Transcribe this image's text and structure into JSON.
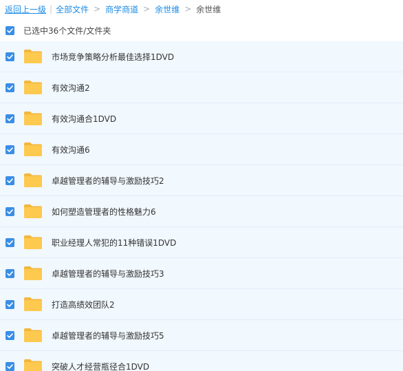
{
  "breadcrumb": {
    "back": "返回上一级",
    "separator": "|",
    "items": [
      "全部文件",
      "商学商道",
      "余世维"
    ],
    "current": "余世维"
  },
  "selection": {
    "text": "已选中36个文件/文件夹",
    "checked": true
  },
  "files": [
    {
      "name": "市场竞争策略分析最佳选择1DVD",
      "checked": true
    },
    {
      "name": "有效沟通2",
      "checked": true
    },
    {
      "name": "有效沟通合1DVD",
      "checked": true
    },
    {
      "name": "有效沟通6",
      "checked": true
    },
    {
      "name": "卓越管理者的辅导与激励技巧2",
      "checked": true
    },
    {
      "name": "如何塑造管理者的性格魅力6",
      "checked": true
    },
    {
      "name": "职业经理人常犯的11种错误1DVD",
      "checked": true
    },
    {
      "name": "卓越管理者的辅导与激励技巧3",
      "checked": true
    },
    {
      "name": "打造高绩效团队2",
      "checked": true
    },
    {
      "name": "卓越管理者的辅导与激励技巧5",
      "checked": true
    },
    {
      "name": "突破人才经营瓶径合1DVD",
      "checked": true
    }
  ],
  "colors": {
    "link": "#1c8ce6",
    "checkbox": "#3a8ee6",
    "row_bg": "#f1f8fe",
    "folder": "#fdc94f"
  },
  "icons": {
    "checkbox": "check-icon",
    "file": "folder-icon",
    "breadcrumb_sep": "chevron-right-icon"
  }
}
